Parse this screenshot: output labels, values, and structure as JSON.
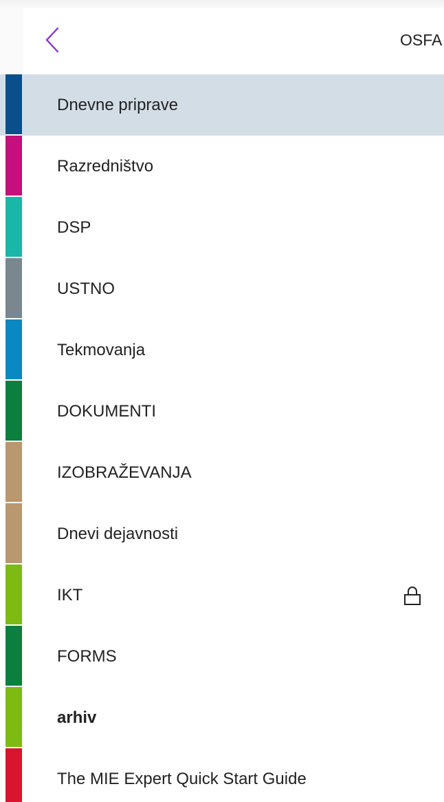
{
  "header": {
    "back_icon": "chevron-left-icon",
    "notebook_title": "OSFA"
  },
  "colors": {
    "back_arrow": "#8a3fc7",
    "selected_bg": "#d3dde6"
  },
  "sections": [
    {
      "label": "Dnevne priprave",
      "color": "#0b4f8a",
      "selected": true
    },
    {
      "label": "Razredništvo",
      "color": "#c40f7d"
    },
    {
      "label": "DSP",
      "color": "#19b7a8"
    },
    {
      "label": "USTNO",
      "color": "#7a878f"
    },
    {
      "label": "Tekmovanja",
      "color": "#0a88c4"
    },
    {
      "label": "DOKUMENTI",
      "color": "#0a7f3e"
    },
    {
      "label": "IZOBRAŽEVANJA",
      "color": "#b9976f"
    },
    {
      "label": "Dnevi dejavnosti",
      "color": "#b9976f"
    },
    {
      "label": "IKT",
      "color": "#7dbb12",
      "locked": true,
      "icon": "lock-icon"
    },
    {
      "label": "FORMS",
      "color": "#0a7f3e"
    },
    {
      "label": "arhiv",
      "color": "#7dbb12",
      "bold": true
    },
    {
      "label": "The MIE Expert Quick Start Guide",
      "color": "#d7152f"
    }
  ]
}
